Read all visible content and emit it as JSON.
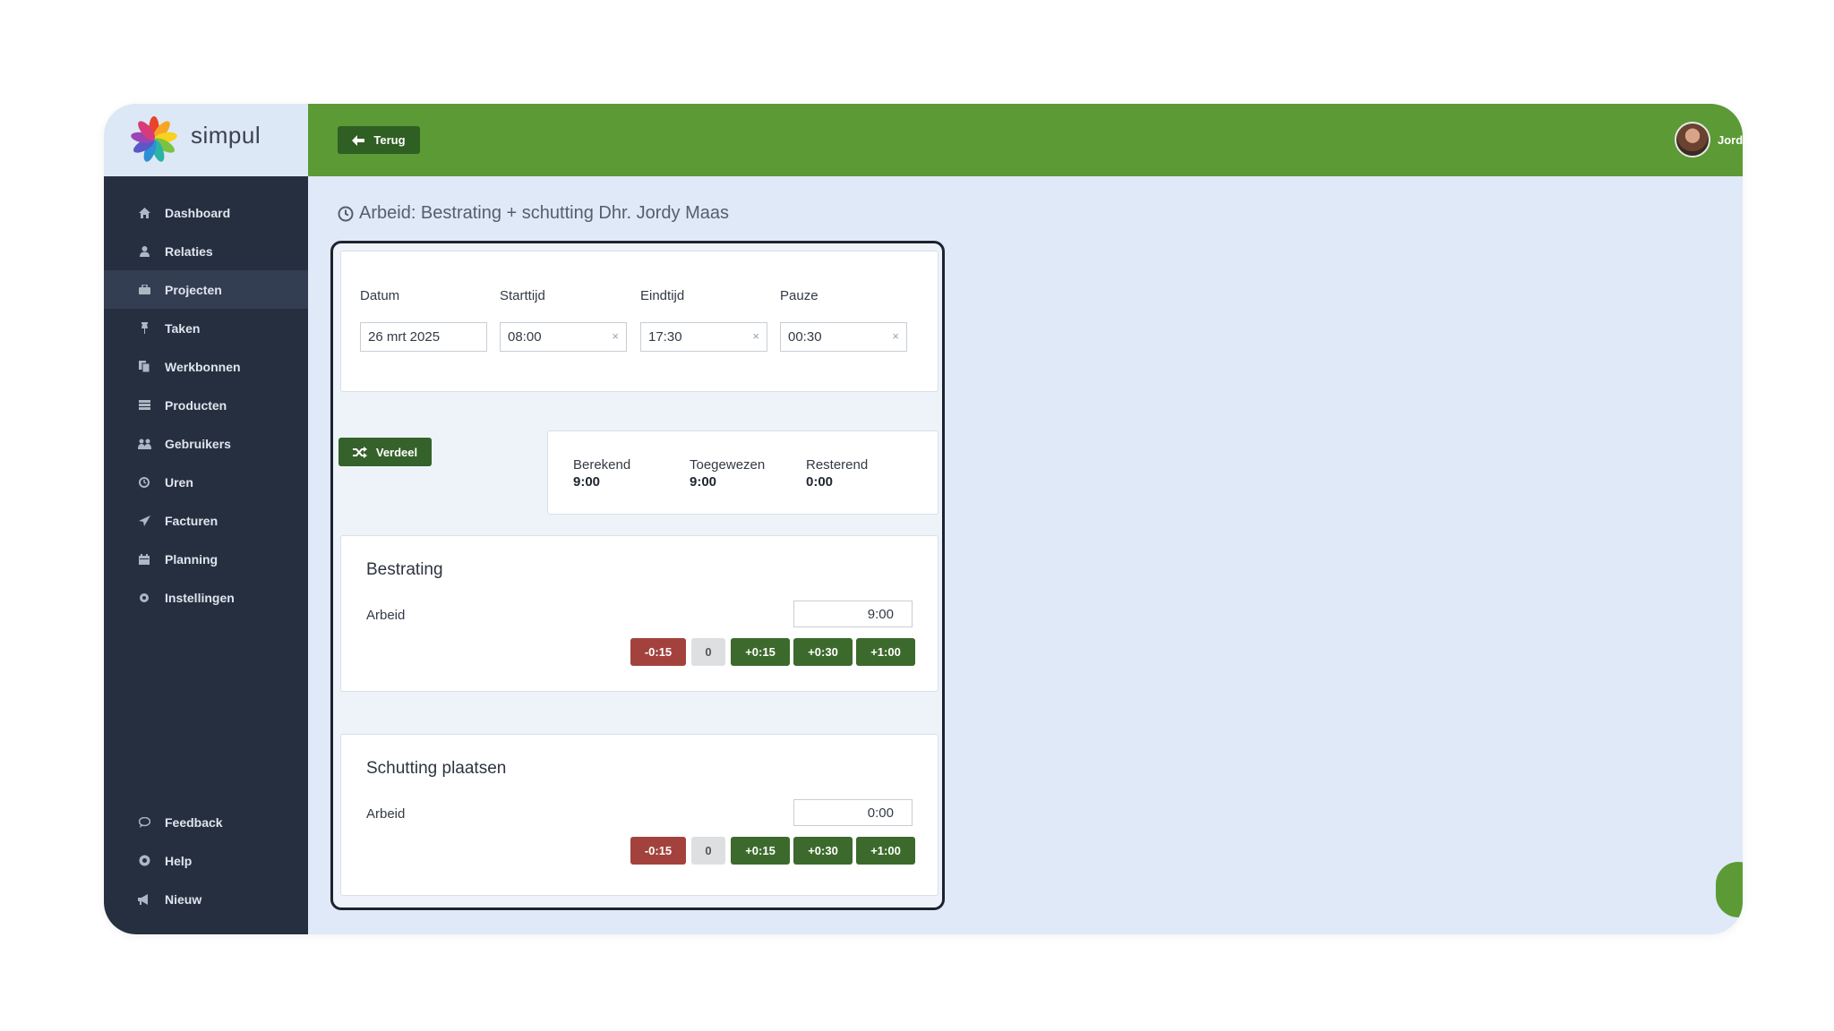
{
  "brand": {
    "name": "simpul"
  },
  "topbar": {
    "back_label": "Terug",
    "user_name": "Jordy"
  },
  "sidebar": {
    "items": [
      {
        "label": "Dashboard",
        "icon": "home-icon"
      },
      {
        "label": "Relaties",
        "icon": "user-icon"
      },
      {
        "label": "Projecten",
        "icon": "briefcase-icon",
        "active": true
      },
      {
        "label": "Taken",
        "icon": "pin-icon"
      },
      {
        "label": "Werkbonnen",
        "icon": "documents-icon"
      },
      {
        "label": "Producten",
        "icon": "list-icon"
      },
      {
        "label": "Gebruikers",
        "icon": "users-icon"
      },
      {
        "label": "Uren",
        "icon": "clock-icon"
      },
      {
        "label": "Facturen",
        "icon": "send-icon"
      },
      {
        "label": "Planning",
        "icon": "calendar-icon"
      },
      {
        "label": "Instellingen",
        "icon": "gear-icon"
      }
    ],
    "bottom_items": [
      {
        "label": "Feedback",
        "icon": "comment-icon"
      },
      {
        "label": "Help",
        "icon": "help-icon"
      },
      {
        "label": "Nieuw",
        "icon": "megaphone-icon"
      }
    ]
  },
  "page": {
    "title": "Arbeid: Bestrating + schutting Dhr. Jordy Maas"
  },
  "time_form": {
    "date_label": "Datum",
    "date_value": "26 mrt 2025",
    "start_label": "Starttijd",
    "start_value": "08:00",
    "end_label": "Eindtijd",
    "end_value": "17:30",
    "pause_label": "Pauze",
    "pause_value": "00:30"
  },
  "distribute": {
    "button_label": "Verdeel"
  },
  "summary": {
    "calculated_label": "Berekend",
    "calculated_value": "9:00",
    "assigned_label": "Toegewezen",
    "assigned_value": "9:00",
    "remaining_label": "Resterend",
    "remaining_value": "0:00"
  },
  "adjust_labels": {
    "minus15": "-0:15",
    "zero": "0",
    "plus15": "+0:15",
    "plus30": "+0:30",
    "plus60": "+1:00"
  },
  "tasks": [
    {
      "title": "Bestrating",
      "row_label": "Arbeid",
      "value": "9:00"
    },
    {
      "title": "Schutting plaatsen",
      "row_label": "Arbeid",
      "value": "0:00"
    }
  ],
  "colors": {
    "topbar": "#5c9a35",
    "sidebar": "#262f40",
    "content_bg": "#dfe9f8",
    "minus_button": "#a3423d",
    "plus_button": "#3c6a2c",
    "zero_button": "#dedfe1"
  }
}
